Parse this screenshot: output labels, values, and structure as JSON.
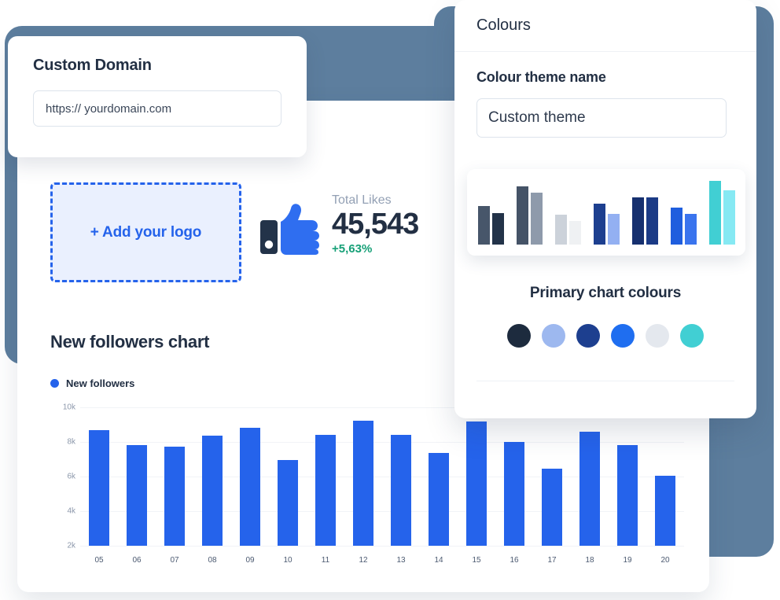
{
  "domain_card": {
    "title": "Custom Domain",
    "input": {
      "value": "https:// yourdomain.com",
      "placeholder": "https:// yourdomain.com"
    }
  },
  "dashboard": {
    "logo_dropzone_label": "+ Add your logo",
    "likes": {
      "label": "Total Likes",
      "value": "45,543",
      "delta": "+5,63%",
      "delta_color": "#16a077",
      "icon": "thumbs-up-icon"
    },
    "chart_title": "New followers chart",
    "legend": [
      {
        "label": "New followers",
        "color": "#2563eb"
      }
    ]
  },
  "colours_panel": {
    "header": "Colours",
    "theme_name_label": "Colour theme name",
    "theme_name_input": {
      "value": "Custom theme",
      "placeholder": "Custom theme"
    },
    "primary_colours_title": "Primary chart colours",
    "swatches": [
      {
        "name": "swatch-dark-navy",
        "color": "#1d2b3e"
      },
      {
        "name": "swatch-light-blue",
        "color": "#9db8ef"
      },
      {
        "name": "swatch-navy",
        "color": "#1d3f8f"
      },
      {
        "name": "swatch-blue",
        "color": "#1f6ef0"
      },
      {
        "name": "swatch-light-grey",
        "color": "#e4e8ee"
      },
      {
        "name": "swatch-teal",
        "color": "#41cfd3"
      }
    ],
    "mini_chart": {
      "type": "bar",
      "title": "",
      "pairs": [
        {
          "bars": [
            {
              "color": "#47566a",
              "value": 58
            },
            {
              "color": "#233349",
              "value": 48
            }
          ]
        },
        {
          "bars": [
            {
              "color": "#455367",
              "value": 88
            },
            {
              "color": "#8e9aab",
              "value": 78
            }
          ]
        },
        {
          "bars": [
            {
              "color": "#ccd2da",
              "value": 45
            },
            {
              "color": "#eff1f3",
              "value": 36
            }
          ]
        },
        {
          "bars": [
            {
              "color": "#1d3f8f",
              "value": 62
            },
            {
              "color": "#93b0f2",
              "value": 46
            }
          ]
        },
        {
          "bars": [
            {
              "color": "#16306f",
              "value": 72
            },
            {
              "color": "#1b3b86",
              "value": 72
            }
          ]
        },
        {
          "bars": [
            {
              "color": "#1f5ede",
              "value": 56
            },
            {
              "color": "#3a74ee",
              "value": 46
            }
          ]
        },
        {
          "bars": [
            {
              "color": "#41cfd3",
              "value": 96
            },
            {
              "color": "#86e9f3",
              "value": 82
            }
          ]
        }
      ]
    }
  },
  "chart_data": {
    "type": "bar",
    "title": "New followers chart",
    "xlabel": "",
    "ylabel": "",
    "categories": [
      "05",
      "06",
      "07",
      "08",
      "09",
      "10",
      "11",
      "12",
      "13",
      "14",
      "15",
      "16",
      "17",
      "18",
      "19",
      "20"
    ],
    "series": [
      {
        "name": "New followers",
        "color": "#2563eb",
        "values": [
          8700,
          7800,
          7750,
          8350,
          8800,
          6950,
          8400,
          9250,
          8400,
          7350,
          9200,
          8000,
          6450,
          8600,
          7800,
          6050
        ]
      }
    ],
    "ytick_labels": [
      "10k",
      "8k",
      "6k",
      "4k",
      "2k"
    ],
    "ytick_values": [
      10000,
      8000,
      6000,
      4000,
      2000
    ],
    "ylim": [
      2000,
      10000
    ],
    "grid": true,
    "legend_position": "top-left"
  }
}
